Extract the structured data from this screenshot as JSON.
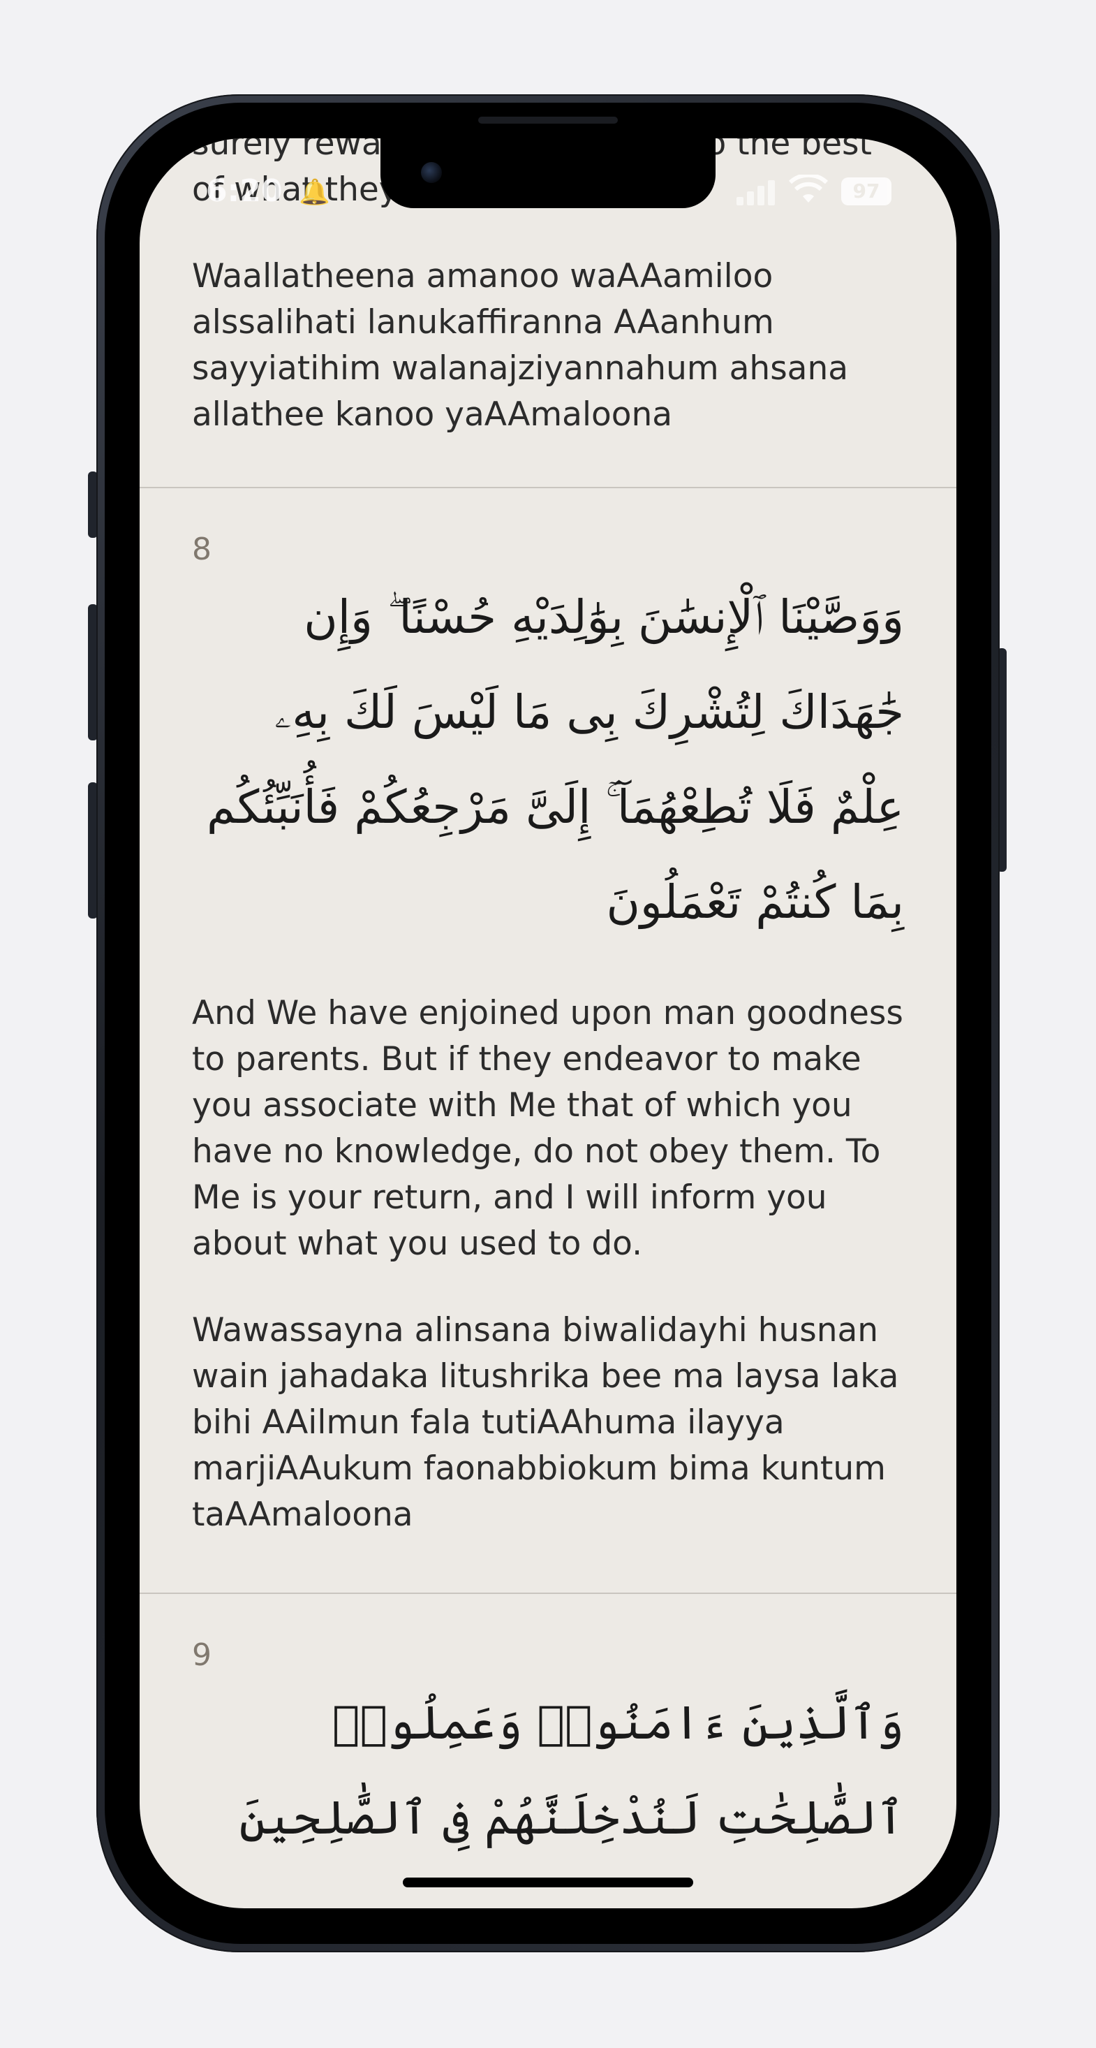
{
  "status_bar": {
    "time": "6:20",
    "bell_icon": "bell-icon",
    "signal_icon": "cellular-signal-icon",
    "wifi_icon": "wifi-icon",
    "battery_level": "97"
  },
  "verses": [
    {
      "number": "",
      "arabic": "",
      "translation_partial_top": "surely reward them according to the best of what they used to do.",
      "transliteration": "Waallatheena amanoo waAAamiloo alssalihati lanukaffiranna AAanhum sayyiatihim walanajziyannahum ahsana allathee kanoo yaAAmaloona"
    },
    {
      "number": "8",
      "arabic": "وَوَصَّيْنَا ٱلْإِنسَٰنَ بِوَٰلِدَيْهِ حُسْنًا ۖ وَإِن جَٰهَدَاكَ لِتُشْرِكَ بِى مَا لَيْسَ لَكَ بِهِۦ عِلْمٌ فَلَا تُطِعْهُمَآ ۚ إِلَىَّ مَرْجِعُكُمْ فَأُنَبِّئُكُم بِمَا كُنتُمْ تَعْمَلُونَ",
      "translation": "And We have enjoined upon man goodness to parents. But if they endeavor to make you associate with Me that of which you have no knowledge, do not obey them. To Me is your return, and I will inform you about what you used to do.",
      "transliteration": "Wawassayna alinsana biwalidayhi husnan wain jahadaka litushrika bee ma laysa laka bihi AAilmun fala tutiAAhuma ilayya marjiAAukum faonabbiokum bima kuntum taAAmaloona"
    },
    {
      "number": "9",
      "arabic": "وَٱلَّذِينَ ءَامَنُوا۟ وَعَمِلُوا۟ ٱلصَّٰلِحَٰتِ لَنُدْخِلَنَّهُمْ فِى ٱلصَّٰلِحِينَ"
    }
  ]
}
